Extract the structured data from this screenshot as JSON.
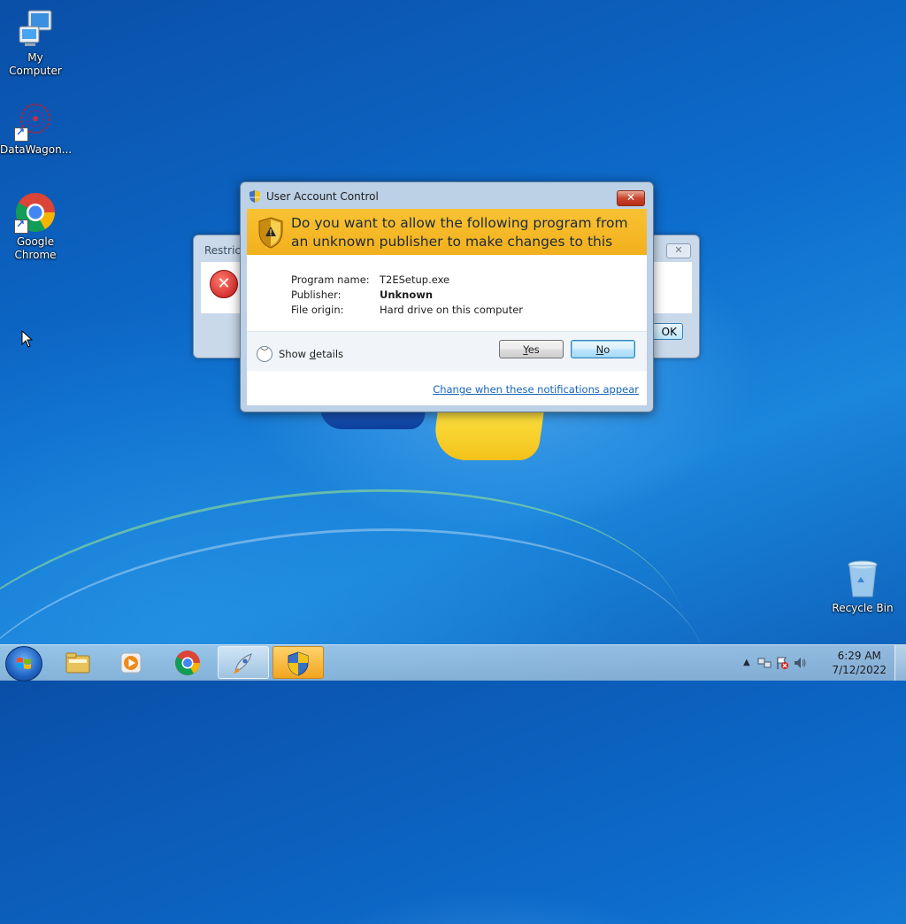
{
  "desktop": {
    "icons": [
      {
        "label": "My Computer"
      },
      {
        "label": "DataWagon..."
      },
      {
        "label": "Google Chrome"
      },
      {
        "label": "Recycle Bin"
      }
    ]
  },
  "background_dialog": {
    "title": "Restricti",
    "close_label": "✕",
    "ok_label": "OK"
  },
  "uac": {
    "title": "User Account Control",
    "close_label": "✕",
    "question": "Do you want to allow the following program from an unknown publisher to make changes to this computer?",
    "details": [
      {
        "key": "Program name:",
        "value": "T2ESetup.exe"
      },
      {
        "key": "Publisher:",
        "value": "Unknown"
      },
      {
        "key": "File origin:",
        "value": "Hard drive on this computer"
      }
    ],
    "show_details": {
      "pre": "Show ",
      "accel": "d",
      "post": "etails"
    },
    "yes": {
      "accel": "Y",
      "rest": "es"
    },
    "no": {
      "accel": "N",
      "rest": "o"
    },
    "link": "Change when these notifications appear"
  },
  "taskbar": {
    "items": [
      {
        "icon": "file-explorer-icon"
      },
      {
        "icon": "media-player-icon"
      },
      {
        "icon": "chrome-icon"
      },
      {
        "icon": "setup-rocket-icon"
      },
      {
        "icon": "uac-shield-icon"
      }
    ],
    "clock": {
      "time": "6:29 AM",
      "date": "7/12/2022"
    }
  },
  "colors": {
    "uac_banner": "#f2b01d",
    "link": "#1765b8",
    "desktop_blue": "#0d6ccc"
  }
}
